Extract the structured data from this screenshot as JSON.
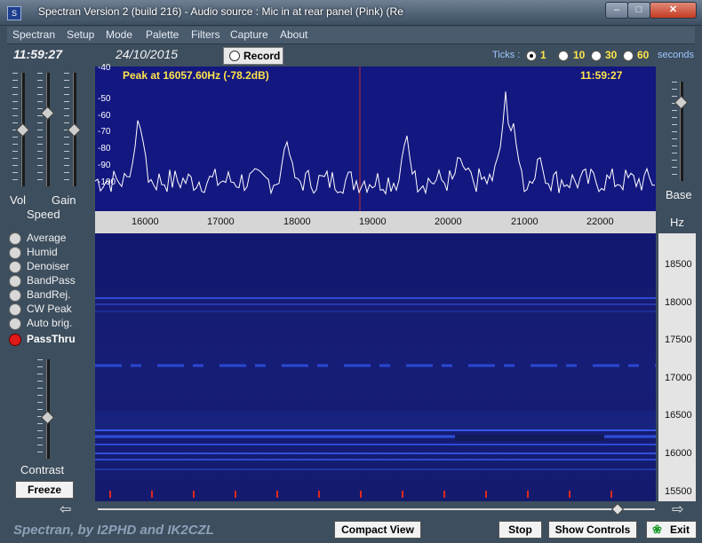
{
  "window": {
    "title": "Spectran Version 2 (build 216) - Audio source  :  Mic in at rear panel (Pink) (Re",
    "app_icon": "spectran-app-icon",
    "controls": {
      "minimize": "–",
      "maximize": "□",
      "close": "✕"
    }
  },
  "menu": [
    "Spectran",
    "Setup",
    "Mode",
    "Palette",
    "Filters",
    "Capture",
    "About"
  ],
  "status": {
    "time": "11:59:27",
    "date": "24/10/2015"
  },
  "record": {
    "label": "Record"
  },
  "ticks": {
    "label": "Ticks :",
    "options": [
      "1",
      "10",
      "30",
      "60"
    ],
    "selected": "1",
    "unit": "seconds"
  },
  "spectrum": {
    "peak": "Peak at 16057.60Hz (-78.2dB)",
    "time": "11:59:27",
    "db_labels": [
      "-40",
      "-50",
      "-60",
      "-70",
      "-80",
      "-90",
      "-100"
    ],
    "freq_labels": [
      "16000",
      "17000",
      "18000",
      "19000",
      "20000",
      "21000",
      "22000"
    ],
    "line_color": "#ffffff",
    "background": "#131780",
    "cursor_color": "#c0302a"
  },
  "waterfall": {
    "time_labels": [
      "18500",
      "18000",
      "17500",
      "17000",
      "16500",
      "16000",
      "15500"
    ]
  },
  "left_panel": {
    "vol_label": "Vol",
    "gain_label": "Gain",
    "speed_label": "Speed",
    "contrast_label": "Contrast",
    "options": [
      {
        "label": "Average",
        "active": false
      },
      {
        "label": "Humid",
        "active": false
      },
      {
        "label": "Denoiser",
        "active": false
      },
      {
        "label": "BandPass",
        "active": false
      },
      {
        "label": "BandRej.",
        "active": false
      },
      {
        "label": "CW Peak",
        "active": false
      },
      {
        "label": "Auto brig.",
        "active": false
      },
      {
        "label": "PassThru",
        "active": true
      }
    ],
    "freeze_label": "Freeze"
  },
  "right_panel": {
    "base_label": "Base",
    "hz_label": "Hz"
  },
  "footer": {
    "credits": "Spectran, by I2PHD and IK2CZL",
    "compact_view": "Compact View",
    "stop": "Stop",
    "show_controls": "Show Controls",
    "exit": "Exit"
  }
}
